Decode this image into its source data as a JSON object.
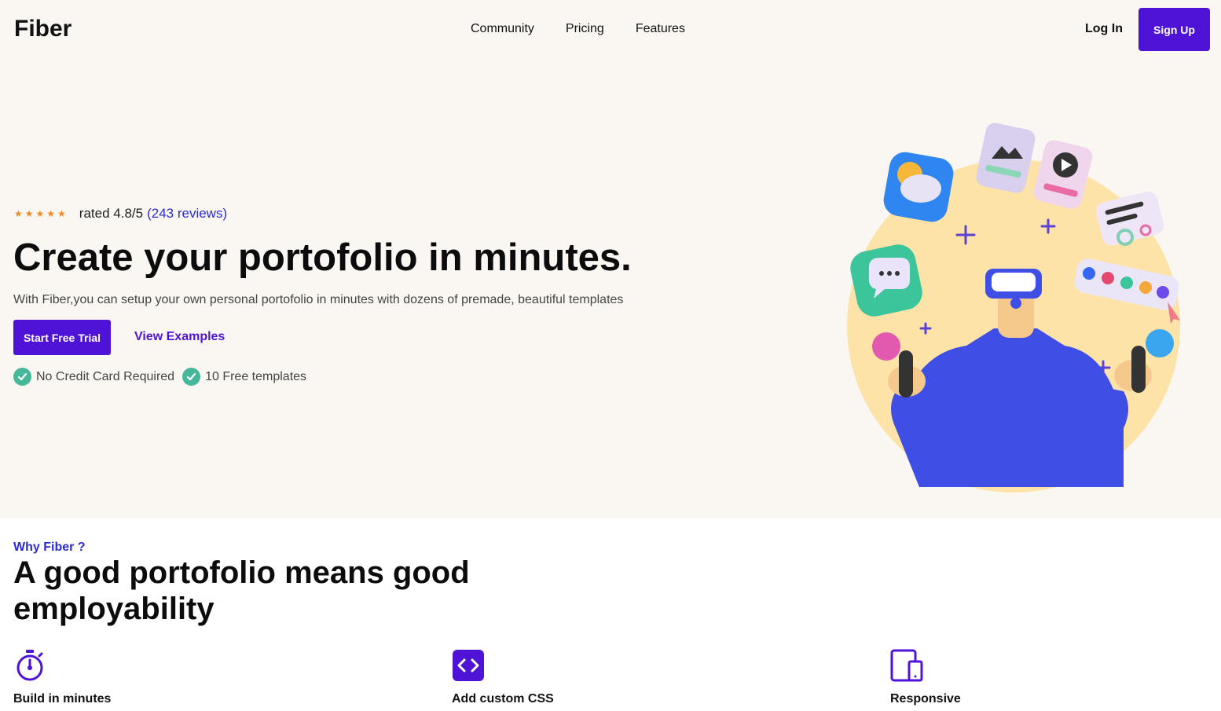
{
  "header": {
    "logo": "Fiber",
    "nav": [
      "Community",
      "Pricing",
      "Features"
    ],
    "login_label": "Log In",
    "signup_label": "Sign Up"
  },
  "hero": {
    "stars_icon": "star-rating-icon",
    "rating_text": "rated 4.8/5",
    "reviews_link": "(243 reviews)",
    "title": "Create your portofolio in minutes.",
    "subtitle": "With Fiber,you can setup your own personal portofolio in minutes with dozens of premade, beautiful templates",
    "cta_primary": "Start Free Trial",
    "cta_secondary": "View Examples",
    "checks": [
      "No Credit Card Required",
      "10 Free templates"
    ]
  },
  "why": {
    "label": "Why Fiber ?",
    "title": "A good portofolio means good employability",
    "features": [
      {
        "icon": "stopwatch-icon",
        "label": "Build in minutes"
      },
      {
        "icon": "code-icon",
        "label": "Add custom CSS"
      },
      {
        "icon": "responsive-devices-icon",
        "label": "Responsive"
      }
    ]
  },
  "colors": {
    "accent": "#4f13d7",
    "link": "#2a2ad6",
    "check_green": "#46b89a",
    "hero_bg": "#faf7f3",
    "star_orange": "#f08a24"
  }
}
